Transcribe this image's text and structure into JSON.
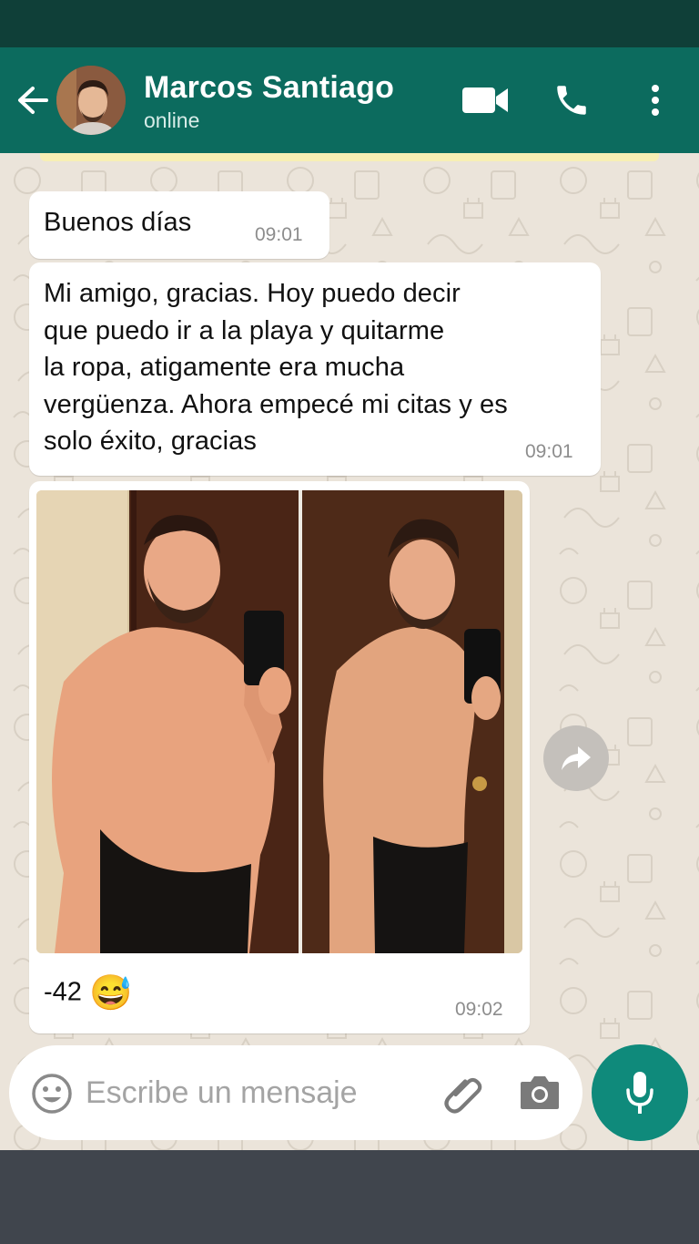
{
  "header": {
    "contact_name": "Marcos Santiago",
    "status": "online",
    "avatar_icon": "person-avatar",
    "back_icon": "arrow-left-icon",
    "video_icon": "video-camera-icon",
    "call_icon": "phone-icon",
    "menu_icon": "more-vertical-icon"
  },
  "messages": [
    {
      "text": "Buenos días",
      "time": "09:01"
    },
    {
      "lines": [
        "Mi amigo, gracias. Hoy puedo decir",
        "que puedo ir a la playa y quitarme",
        "la ropa, atigamente era mucha",
        "vergüenza. Ahora empecé mi citas y es",
        "solo éxito, gracias"
      ],
      "time": "09:01"
    },
    {
      "caption": "-42",
      "emoji": "😅",
      "time": "09:02",
      "image": "before and after shirtless mirror photo"
    }
  ],
  "forward_icon": "forward-arrow-icon",
  "composer": {
    "placeholder": "Escribe un mensaje",
    "emoji_icon": "emoji-icon",
    "attach_icon": "paperclip-icon",
    "camera_icon": "camera-icon",
    "mic_icon": "microphone-icon"
  },
  "colors": {
    "header": "#0c6b5e",
    "status_bar": "#0f3f38",
    "chat_background": "#ebe4da",
    "mic_button": "#0f8a7b"
  }
}
